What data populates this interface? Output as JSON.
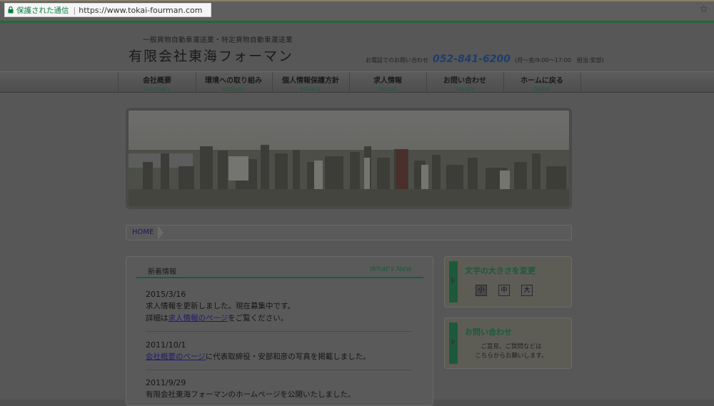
{
  "browser": {
    "secure_label": "保護された通信",
    "url": "https://www.tokai-fourman.com"
  },
  "header": {
    "sub_tagline": "一般貨物自動車運送業・特定貨物自動車運送業",
    "company_name": "有限会社東海フォーマン",
    "phone_label": "お電話でのお問い合わせ",
    "phone_number": "052-841-6200",
    "phone_hours": "(月〜金/9:00〜17:00　担当:安部)"
  },
  "nav": {
    "items": [
      {
        "jp": "会社概要",
        "en": "summary"
      },
      {
        "jp": "環境への取り組み",
        "en": "ecology"
      },
      {
        "jp": "個人情報保護方針",
        "en": "privacy"
      },
      {
        "jp": "求人情報",
        "en": "recruit"
      },
      {
        "jp": "お問い合わせ",
        "en": "inquiry"
      },
      {
        "jp": "ホームに戻る",
        "en": "home"
      }
    ]
  },
  "breadcrumb": {
    "home": "HOME"
  },
  "news": {
    "title": "新着情報",
    "title_en": "What's New",
    "entries": [
      {
        "date": "2015/3/16",
        "line1": "求人情報を更新しました。現在募集中です。",
        "line2_prefix": "詳細は",
        "line2_link": "求人情報のページ",
        "line2_suffix": "をご覧ください。"
      },
      {
        "date": "2011/10/1",
        "link": "会社概要のページ",
        "text": "に代表取締役・安部和彦の写真を掲載しました。"
      },
      {
        "date": "2011/9/29",
        "text": "有限会社東海フォーマンのホームページを公開いたしました。"
      }
    ]
  },
  "font_size_box": {
    "title": "文字の大きさを変更",
    "small": "小",
    "medium": "中",
    "large": "大"
  },
  "contact_box": {
    "title": "お問い合わせ",
    "line1": "ご意見、ご質問などは",
    "line2": "こちらからお願いします。"
  }
}
